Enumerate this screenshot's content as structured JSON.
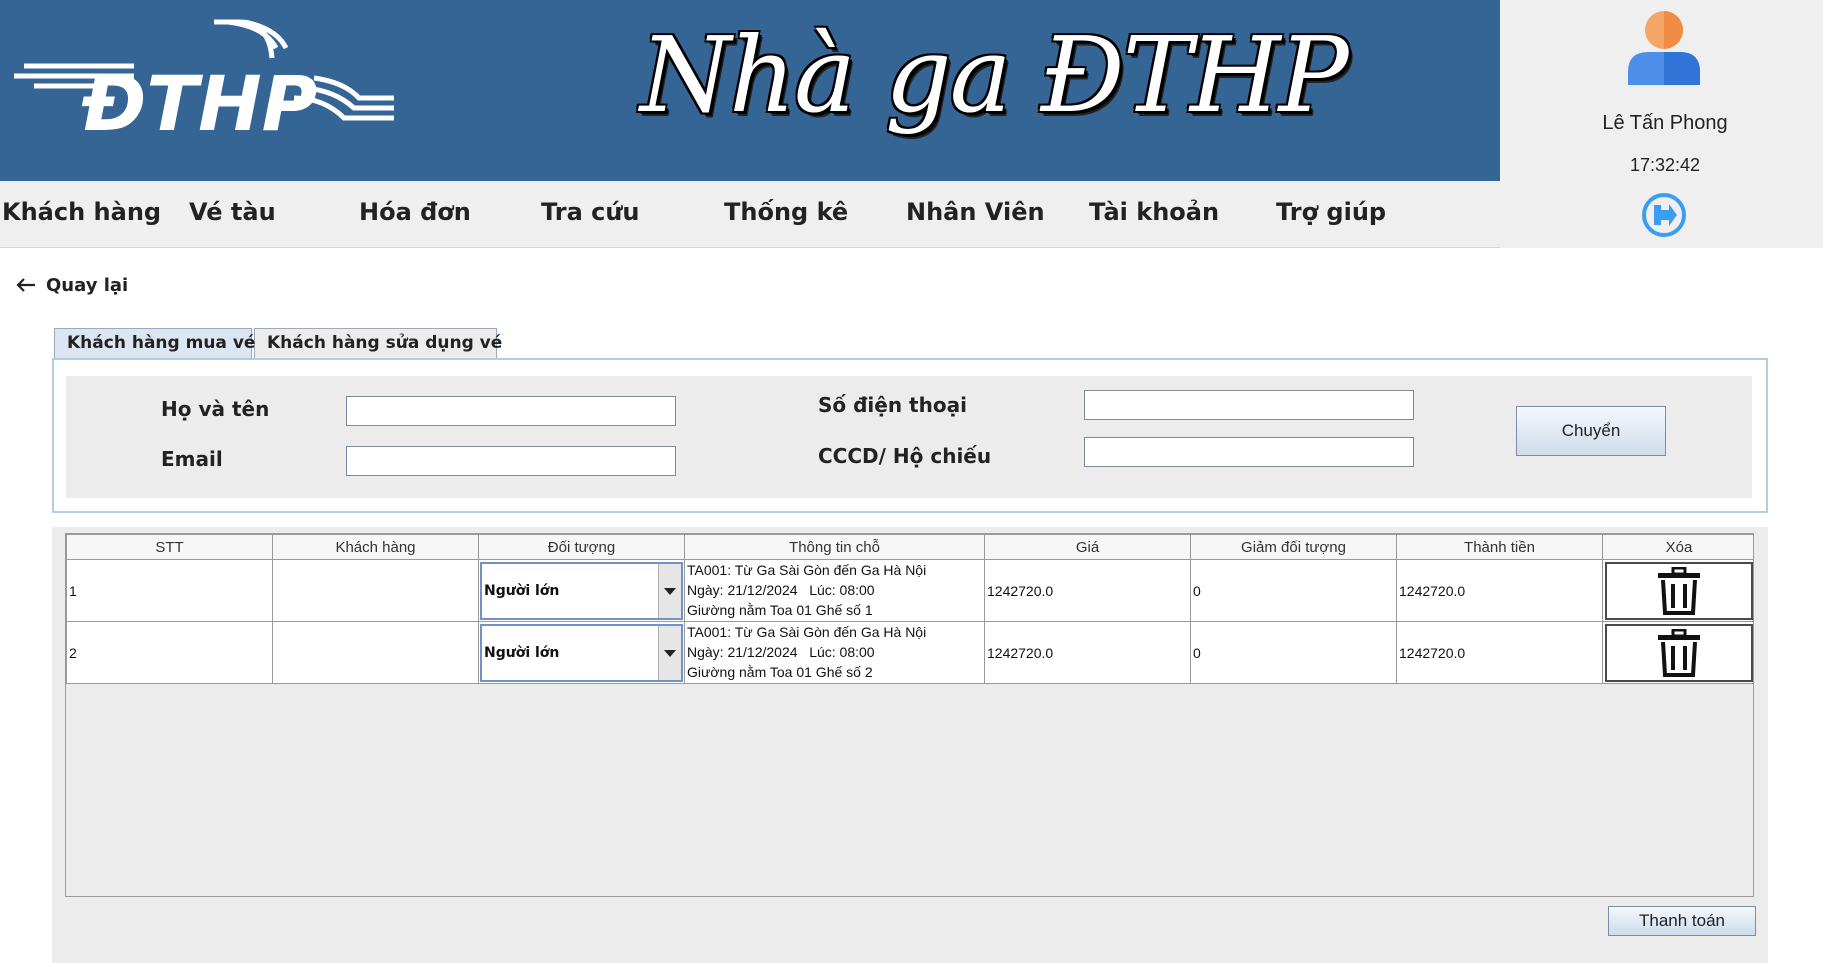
{
  "header": {
    "logo_text": "ĐTHP",
    "title": "Nhà ga ĐTHP"
  },
  "user": {
    "name": "Lê Tấn Phong",
    "time": "17:32:42"
  },
  "menu": [
    "Khách hàng",
    "Vé tàu",
    "Hóa đơn",
    "Tra cứu",
    "Thống kê",
    "Nhân Viên",
    "Tài khoản",
    "Trợ giúp"
  ],
  "back_label": "Quay lại",
  "tabs": [
    "Khách hàng mua vé",
    "Khách hàng sửa dụng vé"
  ],
  "form": {
    "name_label": "Họ và tên",
    "email_label": "Email",
    "phone_label": "Số điện thoại",
    "id_label": "CCCD/ Hộ chiếu",
    "name_value": "",
    "email_value": "",
    "phone_value": "",
    "id_value": "",
    "transfer_button": "Chuyển"
  },
  "table": {
    "columns": [
      "STT",
      "Khách hàng",
      "Đối tượng",
      "Thông tin chỗ",
      "Giá",
      "Giảm đối tượng",
      "Thành tiền",
      "Xóa"
    ],
    "rows": [
      {
        "stt": "1",
        "customer": "",
        "type": "Người lớn",
        "info_line1": "TA001: Từ Ga Sài Gòn đến Ga Hà Nội",
        "info_line2": "Ngày: 21/12/2024   Lúc: 08:00",
        "info_line3": "Giường nằm Toa 01 Ghế số 1",
        "price": "1242720.0",
        "discount": "0",
        "total": "1242720.0"
      },
      {
        "stt": "2",
        "customer": "",
        "type": "Người lớn",
        "info_line1": "TA001: Từ Ga Sài Gòn đến Ga Hà Nội",
        "info_line2": "Ngày: 21/12/2024   Lúc: 08:00",
        "info_line3": "Giường nằm Toa 01 Ghế số 2",
        "price": "1242720.0",
        "discount": "0",
        "total": "1242720.0"
      }
    ]
  },
  "pay_button": "Thanh toán",
  "icons": {
    "logo": "dthp-train-logo",
    "avatar": "user-avatar-icon",
    "logout": "logout-icon",
    "back": "arrow-left-icon",
    "delete": "trash-icon",
    "dropdown": "dropdown-arrow-icon"
  },
  "colors": {
    "banner": "#346595",
    "menu_bg": "#efefef",
    "panel_border": "#b3cde5",
    "logout_icon": "#3b9df0"
  }
}
